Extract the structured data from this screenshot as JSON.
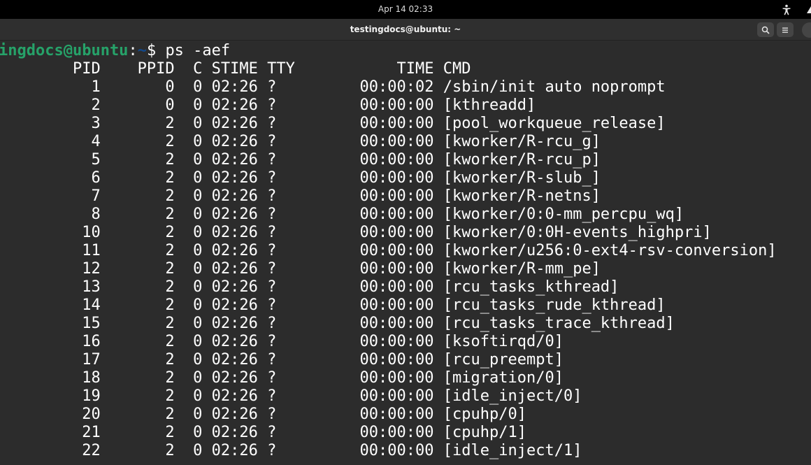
{
  "topbar": {
    "clock": "Apr 14  02:33",
    "accessibility_icon": "accessibility-icon"
  },
  "window": {
    "title": "testingdocs@ubuntu: ~",
    "search_icon": "search-icon",
    "menu_icon": "hamburger-menu-icon",
    "colors": {
      "background": "#2c2c2c",
      "prompt_user": "#26a269",
      "prompt_path": "#12488b",
      "text": "#ffffff"
    }
  },
  "terminal": {
    "prompt": {
      "user_host": "ingdocs@ubuntu",
      "separator": ":",
      "path": "~",
      "dollar": "$ ",
      "command": "ps -aef"
    },
    "lines": [
      "        PID    PPID  C STIME TTY           TIME CMD",
      "          1       0  0 02:26 ?         00:00:02 /sbin/init auto noprompt",
      "          2       0  0 02:26 ?         00:00:00 [kthreadd]",
      "          3       2  0 02:26 ?         00:00:00 [pool_workqueue_release]",
      "          4       2  0 02:26 ?         00:00:00 [kworker/R-rcu_g]",
      "          5       2  0 02:26 ?         00:00:00 [kworker/R-rcu_p]",
      "          6       2  0 02:26 ?         00:00:00 [kworker/R-slub_]",
      "          7       2  0 02:26 ?         00:00:00 [kworker/R-netns]",
      "          8       2  0 02:26 ?         00:00:00 [kworker/0:0-mm_percpu_wq]",
      "         10       2  0 02:26 ?         00:00:00 [kworker/0:0H-events_highpri]",
      "         11       2  0 02:26 ?         00:00:00 [kworker/u256:0-ext4-rsv-conversion]",
      "         12       2  0 02:26 ?         00:00:00 [kworker/R-mm_pe]",
      "         13       2  0 02:26 ?         00:00:00 [rcu_tasks_kthread]",
      "         14       2  0 02:26 ?         00:00:00 [rcu_tasks_rude_kthread]",
      "         15       2  0 02:26 ?         00:00:00 [rcu_tasks_trace_kthread]",
      "         16       2  0 02:26 ?         00:00:00 [ksoftirqd/0]",
      "         17       2  0 02:26 ?         00:00:00 [rcu_preempt]",
      "         18       2  0 02:26 ?         00:00:00 [migration/0]",
      "         19       2  0 02:26 ?         00:00:00 [idle_inject/0]",
      "         20       2  0 02:26 ?         00:00:00 [cpuhp/0]",
      "         21       2  0 02:26 ?         00:00:00 [cpuhp/1]",
      "         22       2  0 02:26 ?         00:00:00 [idle_inject/1]"
    ]
  }
}
